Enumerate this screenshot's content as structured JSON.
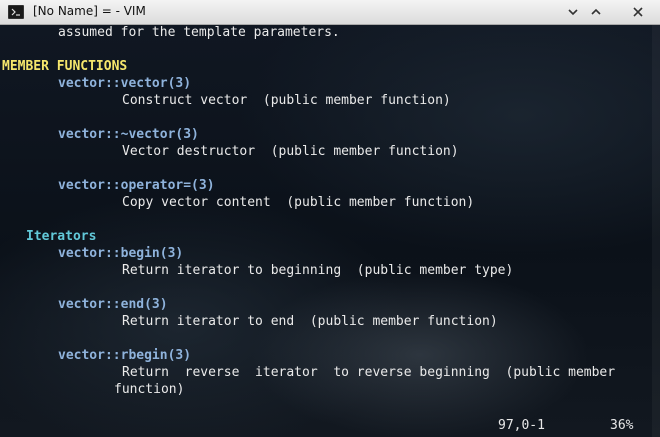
{
  "window": {
    "title": "[No Name] = - VIM",
    "icon": "terminal-icon",
    "controls": [
      "minimize-icon",
      "maximize-icon",
      "close-icon"
    ]
  },
  "colors": {
    "heading": "#f5e66c",
    "subheading": "#62c9d9",
    "function": "#8fb3dc",
    "text": "#eaeaea"
  },
  "doc": {
    "top_line": "assumed for the template parameters.",
    "section_heading": "MEMBER FUNCTIONS",
    "members": [
      {
        "name": "vector::vector(3)",
        "desc": "Construct vector  (public member function)"
      },
      {
        "name": "vector::~vector(3)",
        "desc": "Vector destructor  (public member function)"
      },
      {
        "name": "vector::operator=(3)",
        "desc": "Copy vector content  (public member function)"
      }
    ],
    "iterators_heading": "Iterators",
    "iterators": [
      {
        "name": "vector::begin(3)",
        "desc": "Return iterator to beginning  (public member type)"
      },
      {
        "name": "vector::end(3)",
        "desc": "Return iterator to end  (public member function)"
      },
      {
        "name": "vector::rbegin(3)",
        "desc": "Return  reverse  iterator  to reverse beginning  (public member",
        "desc_cont": "function)"
      }
    ]
  },
  "status": {
    "position": "97,0-1",
    "percent": "36%"
  }
}
